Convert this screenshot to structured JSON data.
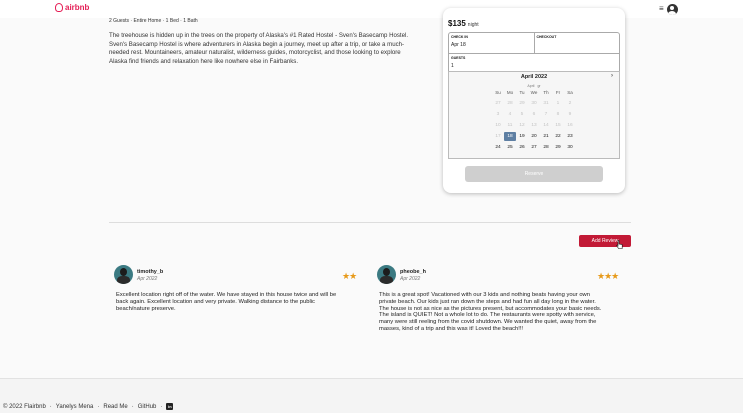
{
  "nav": {
    "brand": "airbnb",
    "menu_icon": "≡"
  },
  "listing": {
    "summary": "2 Guests · Entire Home · 1 Bed · 1 Bath",
    "description": "The treehouse is hidden up in the trees on the property of Alaska's #1 Rated Hostel - Sven's Basecamp Hostel. Sven's Basecamp Hostel is where adventurers in Alaska begin a journey, meet up after a trip, or take a much-needed rest. Mountaineers, amateur naturalist, wilderness guides, motorcyclist, and those looking to explore Alaska find friends and relaxation here like nowhere else in Fairbanks."
  },
  "booking": {
    "price": "$135",
    "price_unit": "night",
    "checkin_label": "CHECK IN",
    "checkin_value": "Apr 18",
    "checkout_label": "CHECKOUT",
    "checkout_value": "",
    "guests_label": "GUESTS",
    "guests_value": "1",
    "reserve_label": "Reserve"
  },
  "calendar": {
    "title": "April 2022",
    "month_select": "April",
    "year_select": "gr",
    "weekdays": [
      "Su",
      "Mo",
      "Tu",
      "We",
      "Th",
      "Fr",
      "Sa"
    ],
    "rows": [
      [
        {
          "d": "27",
          "s": "dim"
        },
        {
          "d": "28",
          "s": "dim"
        },
        {
          "d": "29",
          "s": "dim"
        },
        {
          "d": "30",
          "s": "dim"
        },
        {
          "d": "31",
          "s": "dim"
        },
        {
          "d": "1",
          "s": "dim"
        },
        {
          "d": "2",
          "s": "dim"
        }
      ],
      [
        {
          "d": "3",
          "s": "dim"
        },
        {
          "d": "4",
          "s": "dim"
        },
        {
          "d": "5",
          "s": "dim"
        },
        {
          "d": "6",
          "s": "dim"
        },
        {
          "d": "7",
          "s": "dim"
        },
        {
          "d": "8",
          "s": "dim"
        },
        {
          "d": "9",
          "s": "dim"
        }
      ],
      [
        {
          "d": "10",
          "s": "dim"
        },
        {
          "d": "11",
          "s": "dim"
        },
        {
          "d": "12",
          "s": "dim"
        },
        {
          "d": "13",
          "s": "dim"
        },
        {
          "d": "14",
          "s": "dim"
        },
        {
          "d": "15",
          "s": "dim"
        },
        {
          "d": "16",
          "s": "dim"
        }
      ],
      [
        {
          "d": "17",
          "s": "dim"
        },
        {
          "d": "18",
          "s": "sel"
        },
        {
          "d": "19",
          "s": ""
        },
        {
          "d": "20",
          "s": ""
        },
        {
          "d": "21",
          "s": ""
        },
        {
          "d": "22",
          "s": ""
        },
        {
          "d": "23",
          "s": ""
        }
      ],
      [
        {
          "d": "24",
          "s": ""
        },
        {
          "d": "25",
          "s": ""
        },
        {
          "d": "26",
          "s": ""
        },
        {
          "d": "27",
          "s": ""
        },
        {
          "d": "28",
          "s": ""
        },
        {
          "d": "29",
          "s": ""
        },
        {
          "d": "30",
          "s": ""
        }
      ]
    ]
  },
  "reviews_section": {
    "add_review_label": "Add Review"
  },
  "reviews": [
    {
      "name": "timothy_b",
      "date": "Apr 2022",
      "stars": "★★",
      "body_lines": [
        "Excellent location right off of the water. We have stayed in this house twice and will be",
        "back again. Excellent location and very private. Walking distance to the public",
        "beach/nature preserve."
      ]
    },
    {
      "name": "pheobe_h",
      "date": "Apr 2022",
      "stars": "★★★",
      "body_lines": [
        "This is a great spot! Vacationed with our 3 kids and nothing beats having your own",
        "private beach. Our kids just ran down the steps and had fun all day long in the water.",
        "The house is not as nice as the pictures present, but accommodates your basic needs.",
        "The island is QUIET! Not a whole lot to do. The restaurants were spotty with service,",
        "many were still reeling from the covid shutdown. We wanted the quiet, away from the",
        "masses, kind of a trip and this was it! Loved the beach!!!"
      ]
    }
  ],
  "footer": {
    "copyright": "© 2022 Flairbnb",
    "author": "Yanelys Mena",
    "readme": "Read Me",
    "github": "GitHub",
    "sep": "·",
    "linkedin": "in"
  }
}
